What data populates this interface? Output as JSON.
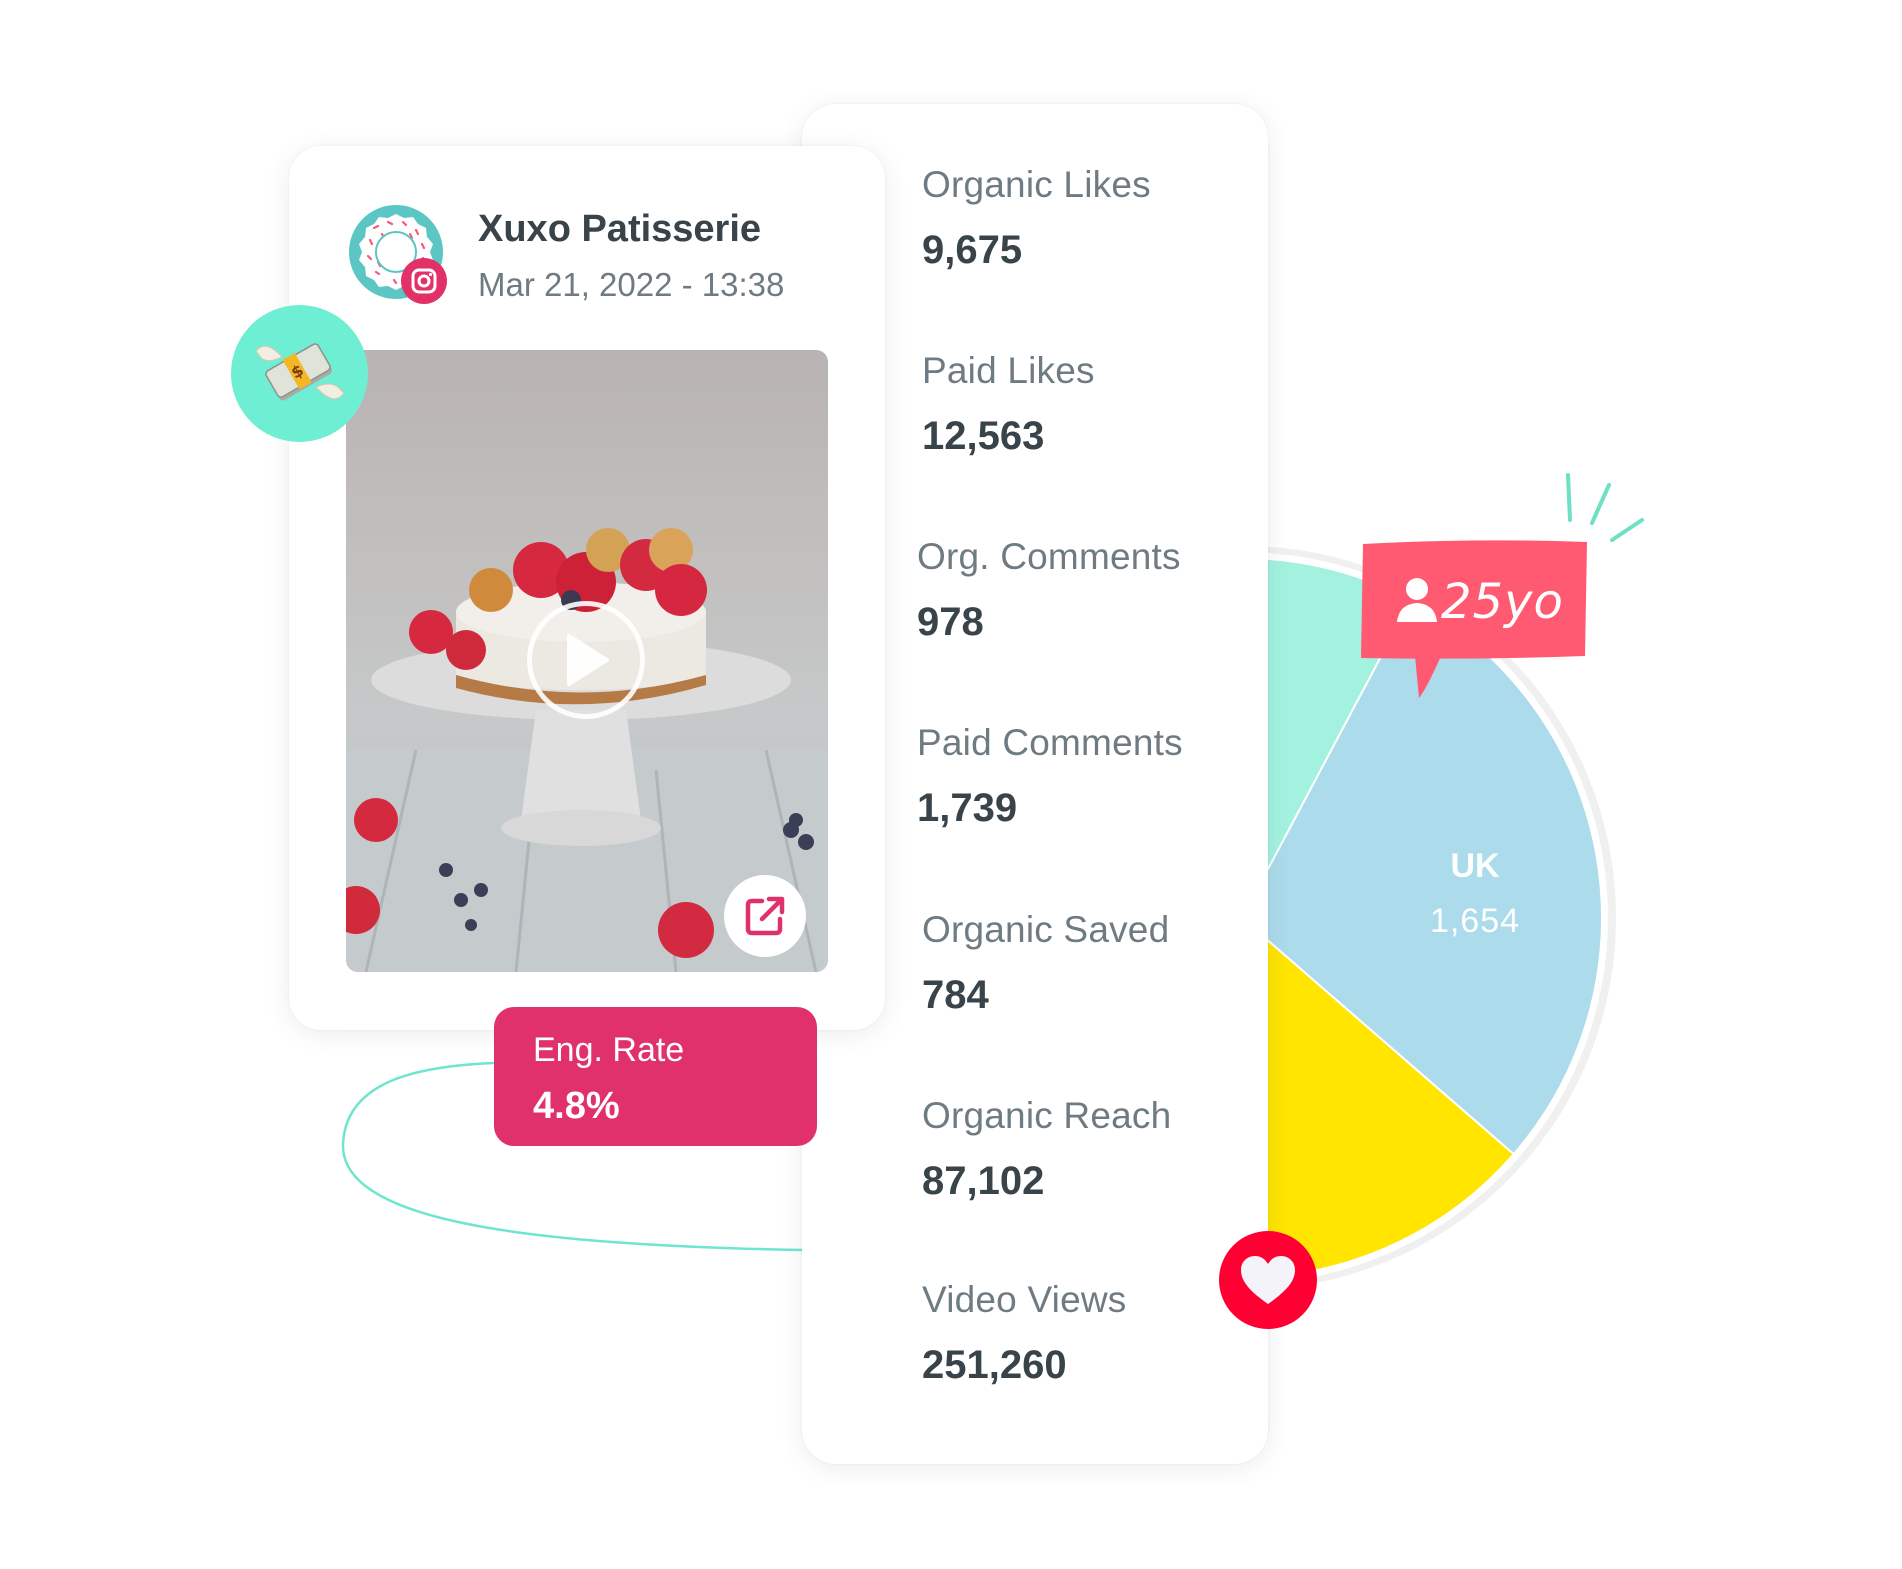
{
  "post": {
    "account_name": "Xuxo Patisserie",
    "date": "Mar 21, 2022 - 13:38",
    "platform": "instagram",
    "media_type": "video",
    "icons": {
      "avatar": "donut-avatar-icon",
      "platform": "instagram-icon",
      "play": "play-icon",
      "open": "external-link-icon",
      "paid": "money-with-wings-icon"
    }
  },
  "engagement": {
    "label": "Eng. Rate",
    "value": "4.8%"
  },
  "metrics": [
    {
      "label": "Organic Likes",
      "value": "9,675"
    },
    {
      "label": "Paid Likes",
      "value": "12,563"
    },
    {
      "label": "Org. Comments",
      "value": "978"
    },
    {
      "label": "Paid Comments",
      "value": "1,739"
    },
    {
      "label": "Organic Saved",
      "value": "784"
    },
    {
      "label": "Organic Reach",
      "value": "87,102"
    },
    {
      "label": "Video Views",
      "value": "251,260"
    }
  ],
  "audience_badge": {
    "text": "25yo",
    "icon": "user-icon"
  },
  "heart_icon": "heart-icon",
  "colors": {
    "brand_pink": "#e1316c",
    "teal": "#6eefd3",
    "badge_red": "#ff5a71",
    "heart_red": "#ff0033",
    "text_dark": "#39434a",
    "text_muted": "#6f7b82"
  },
  "chart_data": {
    "type": "pie",
    "title": "",
    "slices": [
      {
        "name": "",
        "value": null,
        "color": "#a3f2e0"
      },
      {
        "name": "UK",
        "value": 1654,
        "color": "#acdbec"
      },
      {
        "name": "",
        "value": null,
        "color": "#ffe500"
      }
    ],
    "visible_label": {
      "name": "UK",
      "value": "1,654"
    },
    "note": "pie partially hidden behind metrics card; only UK slice is labeled"
  }
}
